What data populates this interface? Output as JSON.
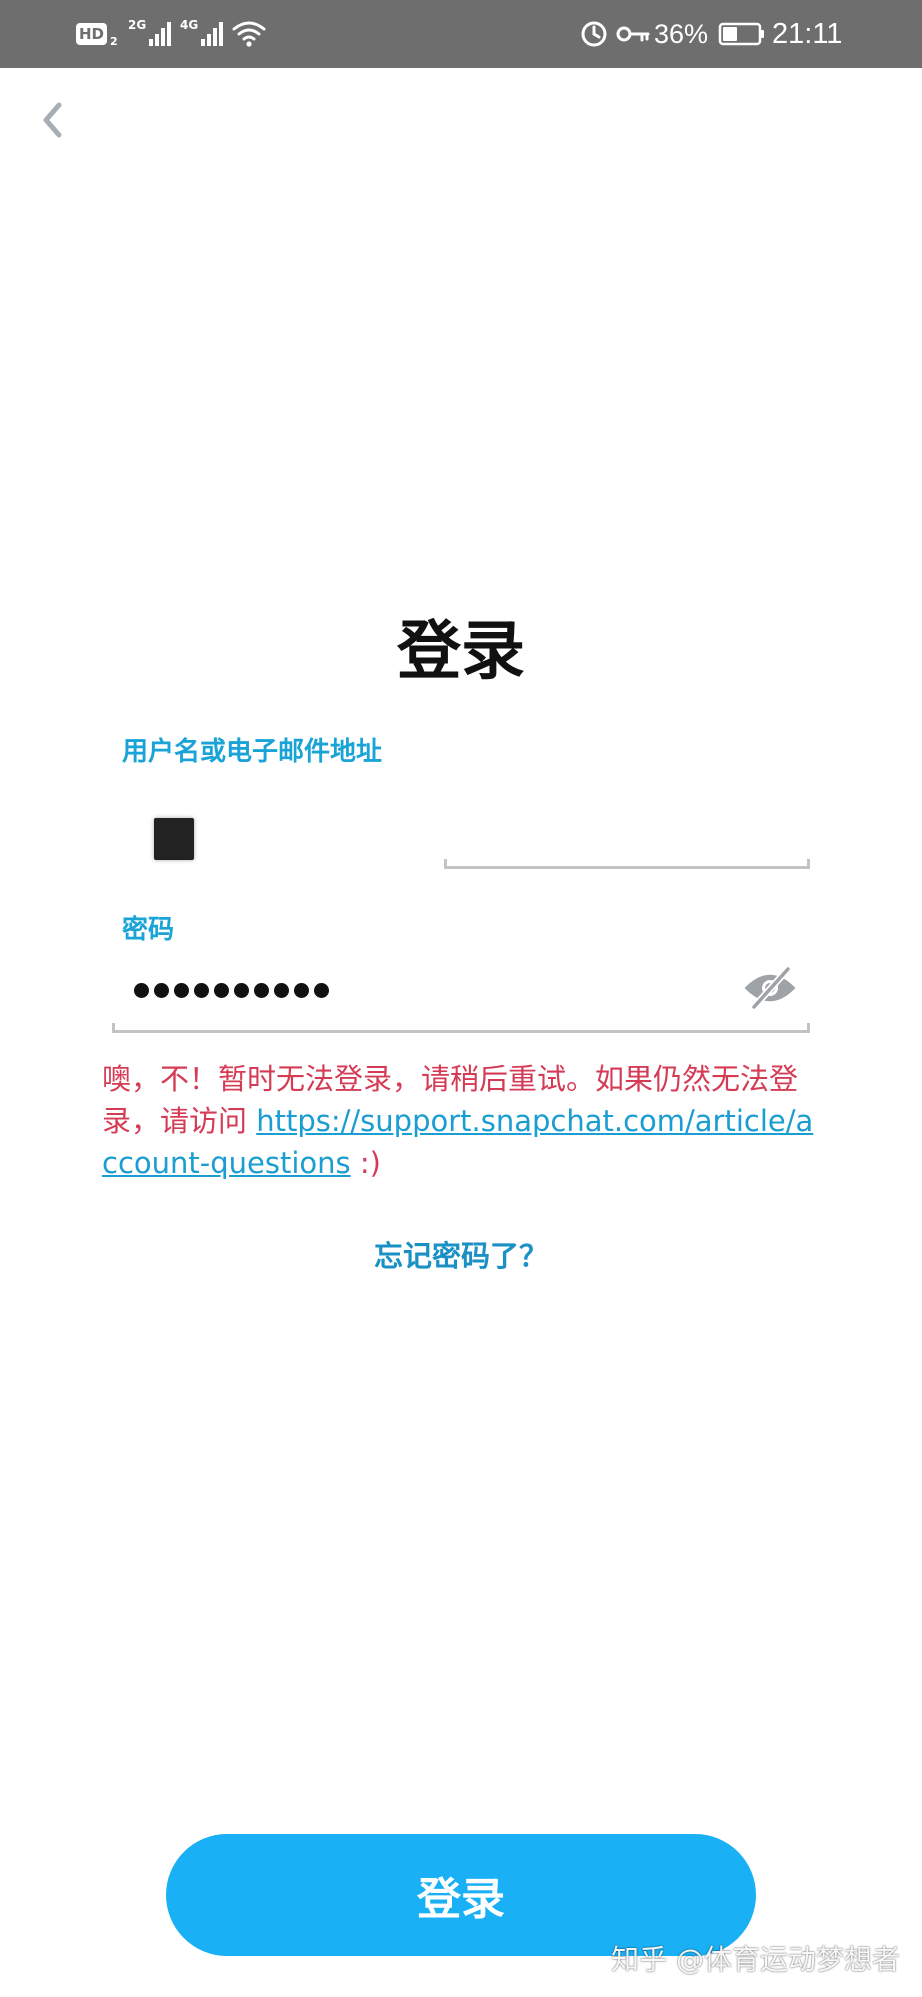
{
  "status_bar": {
    "hd_label": "HD",
    "hd_sub": "2",
    "network_1": "2G",
    "network_2": "4G",
    "battery_percent": "36%",
    "time": "21:11"
  },
  "title": "登录",
  "username": {
    "label": "用户名或电子邮件地址"
  },
  "password": {
    "label": "密码",
    "dot_count": 10
  },
  "error": {
    "message": "噢，不！暂时无法登录，请稍后重试。如果仍然无法登录，请访问 ",
    "link": "https://support.snapchat.com/article/account-questions",
    "suffix": " :)"
  },
  "forgot_password": "忘记密码了？",
  "login_button": "登录",
  "watermark": "知乎 @体育运动梦想者",
  "colors": {
    "accent": "#1ab0f6",
    "label": "#1aa3d6",
    "error": "#d63b55",
    "status_bar": "#6e6e6e"
  }
}
